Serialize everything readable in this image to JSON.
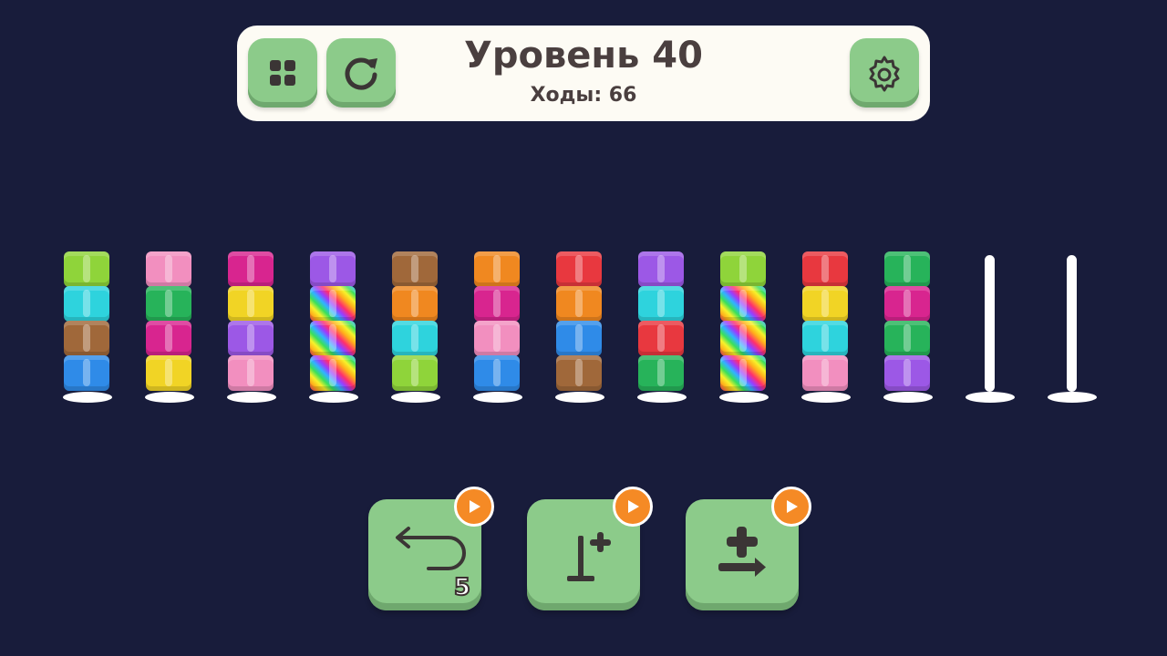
{
  "header": {
    "title": "Уровень 40",
    "moves_label": "Ходы:",
    "moves_value": "66"
  },
  "buttons": {
    "menu_icon": "grid-icon",
    "restart_icon": "restart-icon",
    "settings_icon": "gear-icon"
  },
  "colors": {
    "background": "#181c3b",
    "panel": "#fdfbf4",
    "button": "#8ccb8a",
    "badge": "#f58a25",
    "text": "#4a3f3f"
  },
  "towers": [
    {
      "blocks": [
        "lime",
        "cyan",
        "brown",
        "blue"
      ]
    },
    {
      "blocks": [
        "pink",
        "green",
        "magenta",
        "yellow"
      ]
    },
    {
      "blocks": [
        "magenta",
        "yellow",
        "purple",
        "pink"
      ]
    },
    {
      "blocks": [
        "purple",
        "rainbow",
        "rainbow",
        "rainbow"
      ]
    },
    {
      "blocks": [
        "brown",
        "orange",
        "cyan",
        "lime"
      ]
    },
    {
      "blocks": [
        "orange",
        "magenta",
        "pink",
        "blue"
      ]
    },
    {
      "blocks": [
        "red",
        "orange",
        "blue",
        "brown"
      ]
    },
    {
      "blocks": [
        "purple",
        "cyan",
        "red",
        "green"
      ]
    },
    {
      "blocks": [
        "lime",
        "rainbow",
        "rainbow",
        "rainbow"
      ]
    },
    {
      "blocks": [
        "red",
        "yellow",
        "cyan",
        "pink"
      ]
    },
    {
      "blocks": [
        "green",
        "magenta",
        "green",
        "purple"
      ]
    },
    {
      "blocks": []
    },
    {
      "blocks": []
    }
  ],
  "block_colors": {
    "lime": "#8fd43a",
    "cyan": "#2ed3dd",
    "brown": "#a0683a",
    "blue": "#2f8be8",
    "pink": "#f28fbf",
    "green": "#27b35a",
    "magenta": "#d8258f",
    "yellow": "#f1d425",
    "purple": "#9c58e6",
    "orange": "#f08820",
    "red": "#e8383f"
  },
  "tools": [
    {
      "name": "undo",
      "icon": "undo-icon",
      "count": "5"
    },
    {
      "name": "add-pole",
      "icon": "add-pole-icon",
      "count": ""
    },
    {
      "name": "shuffle",
      "icon": "add-block-icon",
      "count": ""
    }
  ],
  "ad_icon": "play-icon"
}
